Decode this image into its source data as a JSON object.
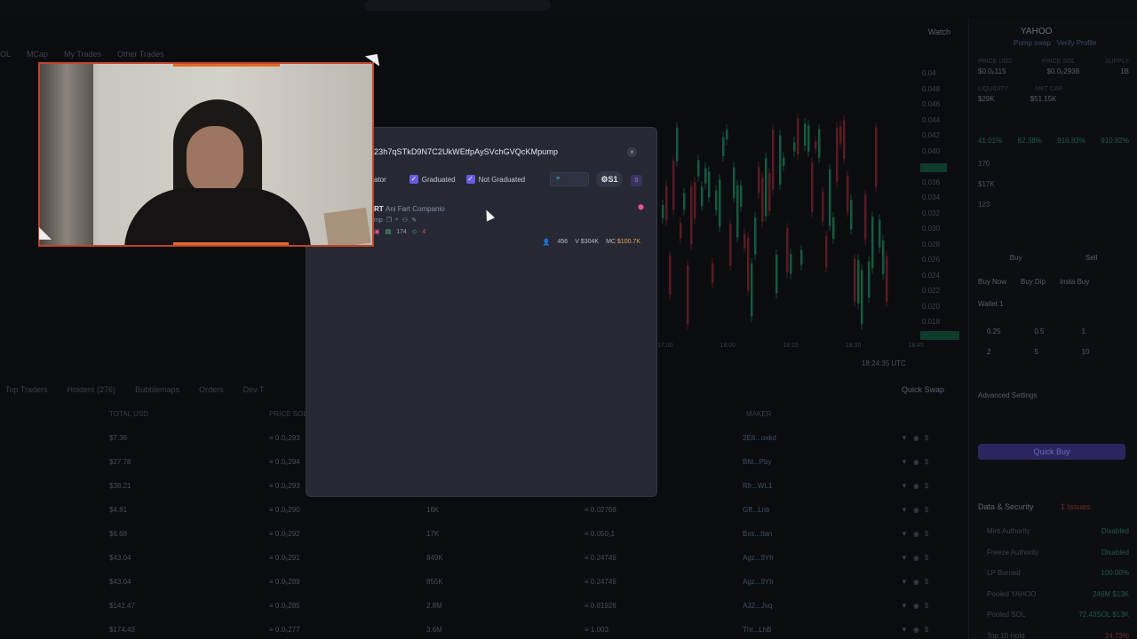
{
  "background": {
    "watch_label": "Watch",
    "filterbar": [
      "OL",
      "MCap",
      "My Trades",
      "Other Trades"
    ],
    "price_ticks": [
      "0.04",
      "0.048",
      "0.046",
      "0.044",
      "0.042",
      "0.040",
      "0.038",
      "0.036",
      "0.034",
      "0.032",
      "0.030",
      "0.028",
      "0.026",
      "0.024",
      "0.022",
      "0.020",
      "0.018"
    ],
    "time_ticks": [
      "17:00",
      "18:00",
      "18:15",
      "18:30",
      "18:45"
    ],
    "utc_label": "18:24:35 UTC",
    "bottom_tabs": [
      "Top Traders",
      "Holders (276)",
      "Bubblemaps",
      "Orders",
      "Dev T"
    ],
    "quick_swap": "Quick Swap",
    "table_headers": [
      "TOTAL USD",
      "PRICE SOL",
      "MAKER"
    ],
    "table_rows": [
      {
        "usd": "$7.36",
        "price": "0.0₆293",
        "amount": "",
        "sol": "",
        "maker": "2E8...oxkd"
      },
      {
        "usd": "$27.78",
        "price": "0.0₆294",
        "amount": "",
        "sol": "",
        "maker": "Bfd...Pby"
      },
      {
        "usd": "$38.21",
        "price": "0.0₆293",
        "amount": "",
        "sol": "",
        "maker": "Rfr...WL1"
      },
      {
        "usd": "$4.81",
        "price": "0.0₆290",
        "amount": "16K",
        "sol": "0.02768",
        "maker": "Gff...Lnb"
      },
      {
        "usd": "$6.68",
        "price": "0.0₆292",
        "amount": "17K",
        "sol": "0.050₁1",
        "maker": "Bxs...Itan"
      },
      {
        "usd": "$43.04",
        "price": "0.0₆291",
        "amount": "849K",
        "sol": "0.24749",
        "maker": "Agz...9Yh"
      },
      {
        "usd": "$43.04",
        "price": "0.0₆289",
        "amount": "855K",
        "sol": "0.24749",
        "maker": "Agz...9Yh"
      },
      {
        "usd": "$142.47",
        "price": "0.0₆285",
        "amount": "2.8M",
        "sol": "0.81926",
        "maker": "A32...Jvq"
      },
      {
        "usd": "$174.43",
        "price": "0.0₆277",
        "amount": "3.6M",
        "sol": "1.003",
        "maker": "Thr...LhB"
      }
    ]
  },
  "right_panel": {
    "title": "YAHOO",
    "sub_links": [
      "Pump swap",
      "Verify Profile"
    ],
    "stat_labels": [
      "PRICE USD",
      "PRICE SOL",
      "SUPPLY",
      "LIQUIDITY",
      "MKT CAP"
    ],
    "stat_values": [
      "$0.0₆115",
      "$0.0₆2938",
      "1B",
      "$29K",
      "$51.15K"
    ],
    "pct_row": [
      "41.01%",
      "82.38%",
      "916.83%",
      "910.82%"
    ],
    "txns": "170",
    "volume": "$17K",
    "makers": "123",
    "buy_tab": "Buy",
    "sell_tab": "Sell",
    "buy_now": "Buy Now",
    "buy_dip": "Buy Dip",
    "insta_buy": "Insta Buy",
    "wallet": "Wallet 1",
    "amounts": [
      "0.25",
      "0.5",
      "1",
      "2",
      "5",
      "10"
    ],
    "advanced": "Advanced Settings",
    "quick_buy": "Quick Buy",
    "data_security": "Data & Security",
    "issues": "1 Issues",
    "security_rows": [
      {
        "label": "Mint Authority",
        "value": "Disabled"
      },
      {
        "label": "Freeze Authority",
        "value": "Disabled"
      },
      {
        "label": "LP Burned",
        "value": "100.00%"
      },
      {
        "label": "Pooled YAHOO",
        "value": "246M $13K"
      },
      {
        "label": "Pooled SOL",
        "value": "72.43SOL $13K"
      },
      {
        "label": "Top 10 Hold",
        "value": "24.73%"
      }
    ]
  },
  "modal": {
    "address": "23h7qSTkD9N7C2UkWEtfpAySVchGVQcKMpump",
    "close": "×",
    "filter_1": "ator",
    "filter_2": "Graduated",
    "filter_3": "Not Graduated",
    "sol_badge": "S1",
    "pair_badge": "0",
    "result": {
      "ticker": "RT",
      "name": "Ani Fart Companio",
      "line2": "mp",
      "comments": "174",
      "alerts": "4",
      "holders": "456",
      "volume": "V $304K",
      "mc_label": "MC",
      "mc_value": "$100.7K"
    }
  }
}
